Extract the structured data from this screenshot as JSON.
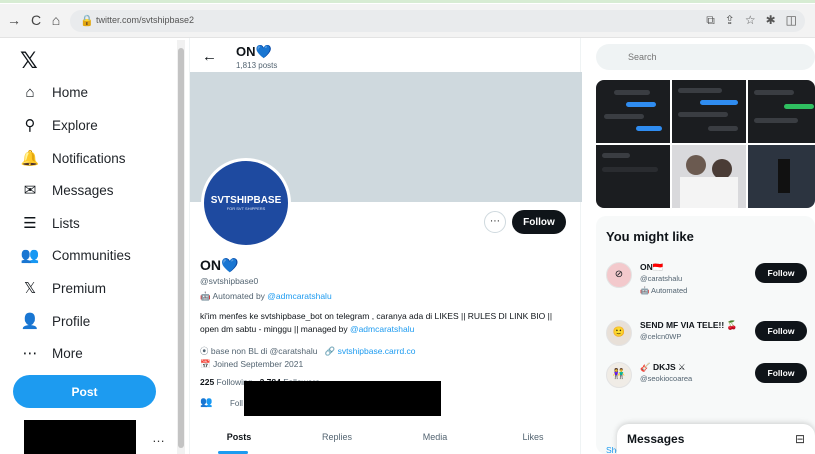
{
  "browser": {
    "url": "twitter.com/svtshipbase2",
    "back_glyph": "→",
    "refresh_glyph": "C",
    "home_glyph": "⌂",
    "lock_glyph": "🔒",
    "tool_glyphs": [
      "⧉",
      "⇪",
      "☆",
      "✱",
      "◫"
    ]
  },
  "nav": {
    "logo": "𝕏",
    "items": [
      {
        "label": "Home",
        "icon": "⌂"
      },
      {
        "label": "Explore",
        "icon": "⚲"
      },
      {
        "label": "Notifications",
        "icon": "🔔"
      },
      {
        "label": "Messages",
        "icon": "✉"
      },
      {
        "label": "Lists",
        "icon": "☰"
      },
      {
        "label": "Communities",
        "icon": "👥"
      },
      {
        "label": "Premium",
        "icon": "𝕏"
      },
      {
        "label": "Profile",
        "icon": "👤"
      },
      {
        "label": "More",
        "icon": "⋯"
      }
    ],
    "post_label": "Post",
    "more_dots": "…"
  },
  "profile": {
    "back_arrow": "←",
    "title": "ON",
    "heart": "💙",
    "post_count": "1,813 posts",
    "avatar_line1": "SVTSHIPBASE",
    "avatar_line2": "FOR SVT SHIPPERS",
    "more_glyph": "⋯",
    "follow_label": "Follow",
    "display_name": "ON",
    "handle": "@svtshipbase0",
    "automated_prefix": "Automated by ",
    "automated_by": "@admcaratshalu",
    "bio_text": "ki'im menfes ke svtshipbase_bot on telegram , caranya ada di LIKES || RULES DI LINK BIO || open dm sabtu - minggu || managed by ",
    "bio_link": "@admcaratshalu",
    "location": "base non BL di @caratshalu",
    "website": "svtshipbase.carrd.co",
    "joined": "Joined September 2021",
    "following_count": "225",
    "following_label": " Following",
    "followers_count": "2,784",
    "followers_label": " Followers",
    "followed_by_avatar": "👥",
    "followed_by_text": "Foll",
    "tabs": [
      "Posts",
      "Replies",
      "Media",
      "Likes"
    ]
  },
  "right": {
    "search_placeholder": "Search",
    "search_icon": "⚲",
    "you_might_like": "You might like",
    "suggestions": [
      {
        "name": "ON🇮🇩",
        "handle": "@caratshalu",
        "extra": "🤖 Automated",
        "avatar": "⊘",
        "follow": "Follow"
      },
      {
        "name": "SEND MF VIA TELE!! 🍒",
        "handle": "@celcn0WP",
        "extra": "",
        "avatar": "🙂",
        "follow": "Follow"
      },
      {
        "name": "🎸 DKJS ⚔",
        "handle": "@seokiocoarea",
        "extra": "",
        "avatar": "👫",
        "follow": "Follow"
      }
    ],
    "show_more": "Show more",
    "messages_title": "Messages",
    "messages_icon": "⊟"
  }
}
